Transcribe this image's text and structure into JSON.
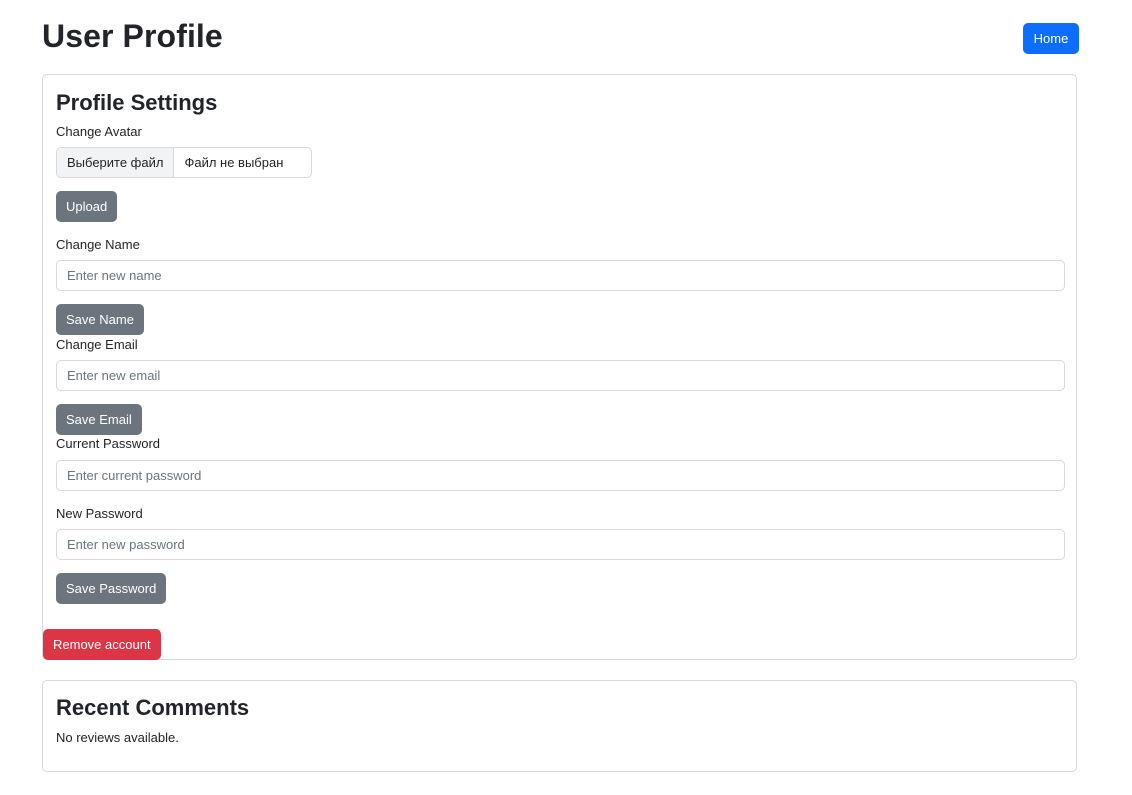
{
  "header": {
    "title": "User Profile",
    "home_label": "Home",
    "home_color": "#0d6efd"
  },
  "profile_settings": {
    "title": "Profile Settings",
    "avatar": {
      "label": "Change Avatar",
      "choose_file_label": "Выберите файл",
      "file_status": "Файл не выбран",
      "upload_label": "Upload"
    },
    "name": {
      "label": "Change Name",
      "placeholder": "Enter new name",
      "value": "",
      "save_label": "Save Name"
    },
    "email": {
      "label": "Change Email",
      "placeholder": "Enter new email",
      "value": "",
      "save_label": "Save Email"
    },
    "current_password": {
      "label": "Current Password",
      "placeholder": "Enter current password",
      "value": ""
    },
    "new_password": {
      "label": "New Password",
      "placeholder": "Enter new password",
      "value": "",
      "save_label": "Save Password"
    },
    "remove_account_label": "Remove account",
    "secondary_button_color": "#6c757d",
    "danger_button_color": "#dc3545"
  },
  "recent_comments": {
    "title": "Recent Comments",
    "empty_message": "No reviews available."
  }
}
